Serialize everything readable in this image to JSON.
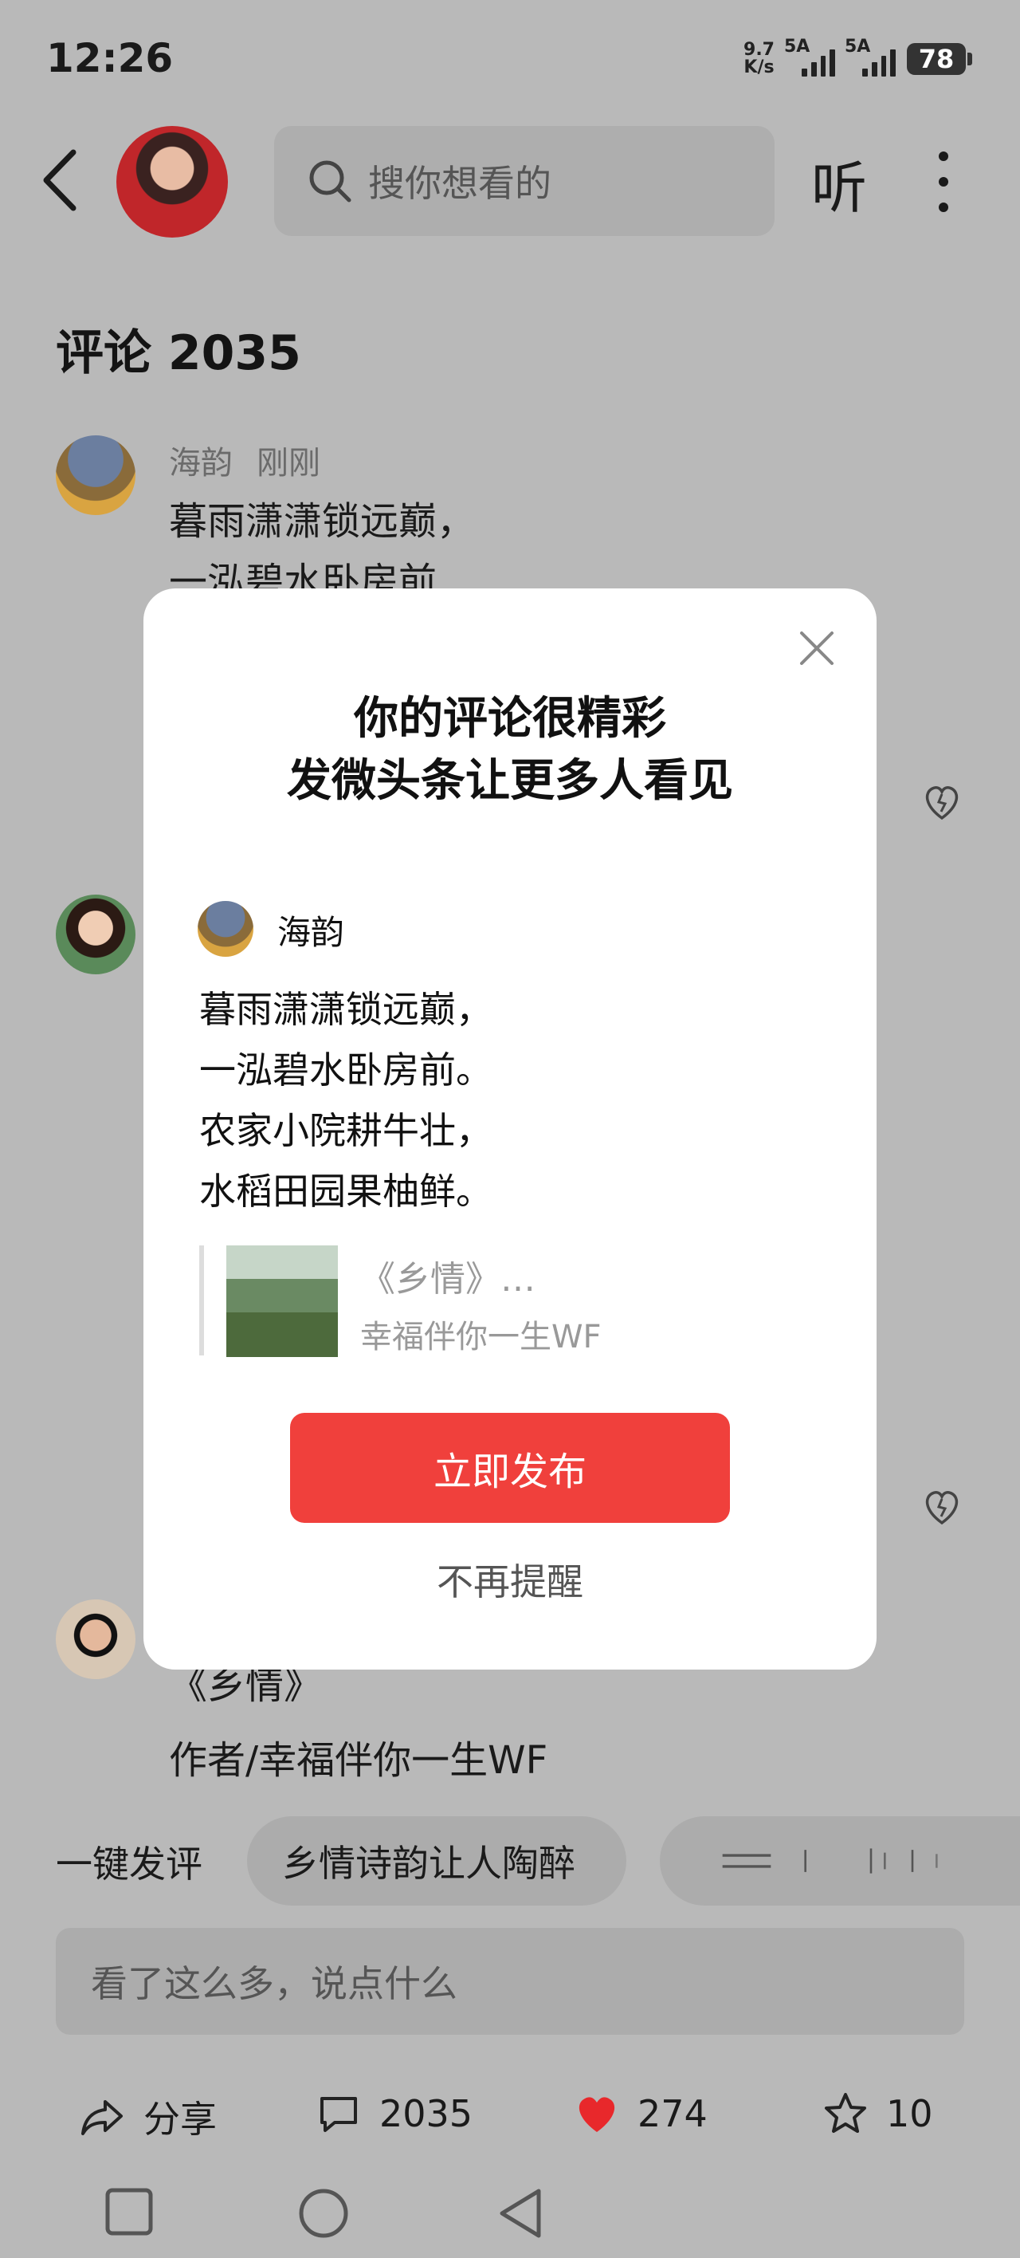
{
  "status": {
    "time": "12:26",
    "net_speed_top": "9.7",
    "net_speed_bottom": "K/s",
    "sim1": "5A",
    "sim2": "5A",
    "battery": "78"
  },
  "header": {
    "search_placeholder": "搜你想看的",
    "listen_label": "听"
  },
  "comments": {
    "title": "评论 2035",
    "first": {
      "author": "海韵",
      "time": "刚刚",
      "line1": "暮雨潇潇锁远巅，",
      "line2": "一泓碧水卧房前"
    },
    "third": {
      "line1": "《乡情》",
      "line2": "作者/幸福伴你一生WF"
    }
  },
  "quick_comment": {
    "label": "一键发评",
    "chips": [
      "乡情诗韵让人陶醉"
    ]
  },
  "input": {
    "placeholder": "看了这么多，说点什么"
  },
  "actions": {
    "share": "分享",
    "comments": "2035",
    "likes": "274",
    "favorites": "10"
  },
  "modal": {
    "title_line1": "你的评论很精彩",
    "title_line2": "发微头条让更多人看见",
    "user_name": "海韵",
    "poem": [
      "暮雨潇潇锁远巅，",
      "一泓碧水卧房前。",
      "农家小院耕牛壮，",
      "水稻田园果柚鲜。"
    ],
    "source_title": "《乡情》…",
    "source_author": "幸福伴你一生WF",
    "publish_label": "立即发布",
    "dismiss_label": "不再提醒"
  },
  "colors": {
    "accent": "#f0403c",
    "overlay_bg": "#b9b9b9",
    "like_red": "#e8282b"
  },
  "icons": [
    "back-icon",
    "search-icon",
    "more-icon",
    "close-icon",
    "heart-icon",
    "share-icon",
    "comment-icon",
    "star-icon"
  ]
}
